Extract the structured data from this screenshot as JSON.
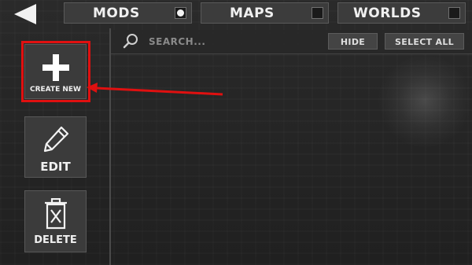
{
  "tabs": [
    {
      "label": "MODS",
      "selected": true
    },
    {
      "label": "MAPS",
      "selected": false
    },
    {
      "label": "WORLDS",
      "selected": false
    }
  ],
  "toolbar": {
    "search_placeholder": "SEARCH...",
    "hide_label": "HIDE",
    "select_all_label": "SELECT ALL"
  },
  "sidebar": {
    "create_new_label": "CREATE NEW",
    "edit_label": "EDIT",
    "delete_label": "DELETE"
  },
  "icons": {
    "back": "back-arrow-icon",
    "search": "magnifier-icon",
    "create": "plus-icon",
    "edit": "pencil-icon",
    "delete": "trash-icon"
  },
  "colors": {
    "highlight": "#e01010",
    "background": "#262626",
    "button": "#3b3b3b"
  }
}
